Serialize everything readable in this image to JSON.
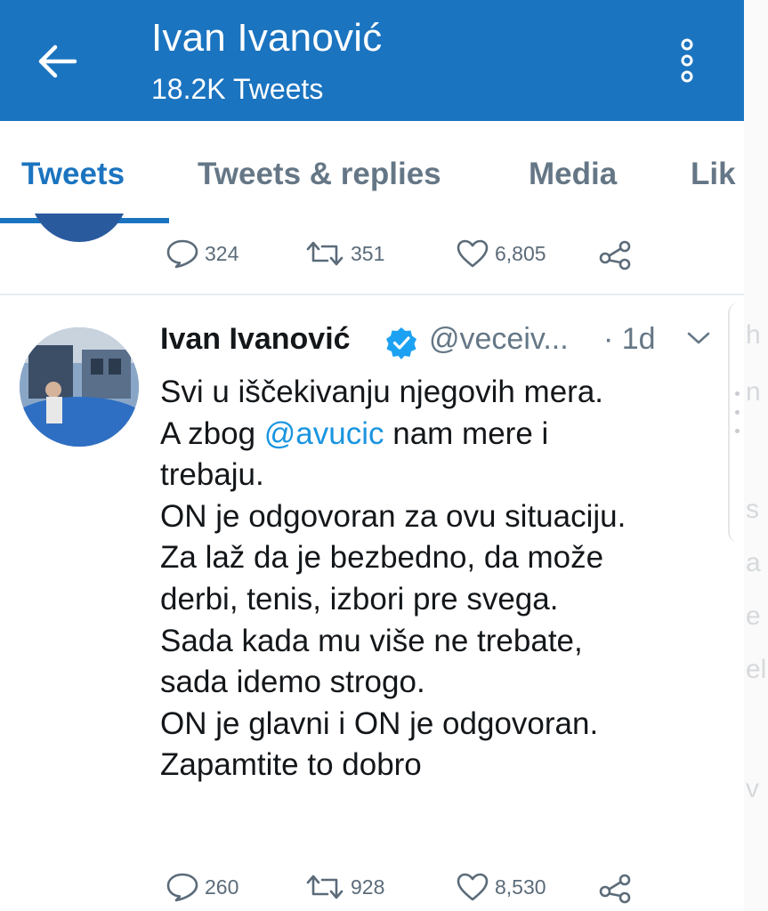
{
  "header": {
    "back_icon": "arrow-left-icon",
    "title": "Ivan Ivanović",
    "subtitle": "18.2K Tweets",
    "overflow_icon": "vertical-dots-icon",
    "background_color": "#1b74c0"
  },
  "tabs": [
    {
      "label": "Tweets",
      "active": true
    },
    {
      "label": "Tweets & replies",
      "active": false
    },
    {
      "label": "Media",
      "active": false
    },
    {
      "label": "Lik",
      "active": false
    }
  ],
  "previous_tweet": {
    "replies": "324",
    "retweets": "351",
    "likes": "6,805"
  },
  "tweet": {
    "author_name": "Ivan Ivanović",
    "verified_icon": "verified-badge-icon",
    "handle": "@veceiv...",
    "time": "· 1d",
    "text_lines": [
      {
        "text": "Svi u iščekivanju njegovih mera."
      },
      {
        "before": "A zbog ",
        "mention": "@avucic",
        "after": " nam mere i"
      },
      {
        "text": "trebaju."
      },
      {
        "text": "ON je odgovoran za ovu situaciju."
      },
      {
        "text": "Za laž da je bezbedno, da može"
      },
      {
        "text": "derbi, tenis, izbori pre svega."
      },
      {
        "text": "Sada kada mu više ne trebate,"
      },
      {
        "text": "sada idemo strogo."
      },
      {
        "text": "ON je glavni i ON je odgovoran."
      },
      {
        "text": "Zapamtite to dobro"
      }
    ],
    "replies": "260",
    "retweets": "928",
    "likes": "8,530",
    "mention_color": "#1b95e0"
  },
  "right_edge_letters": [
    "h",
    "n",
    "s",
    "a",
    "e",
    "el",
    "v"
  ]
}
